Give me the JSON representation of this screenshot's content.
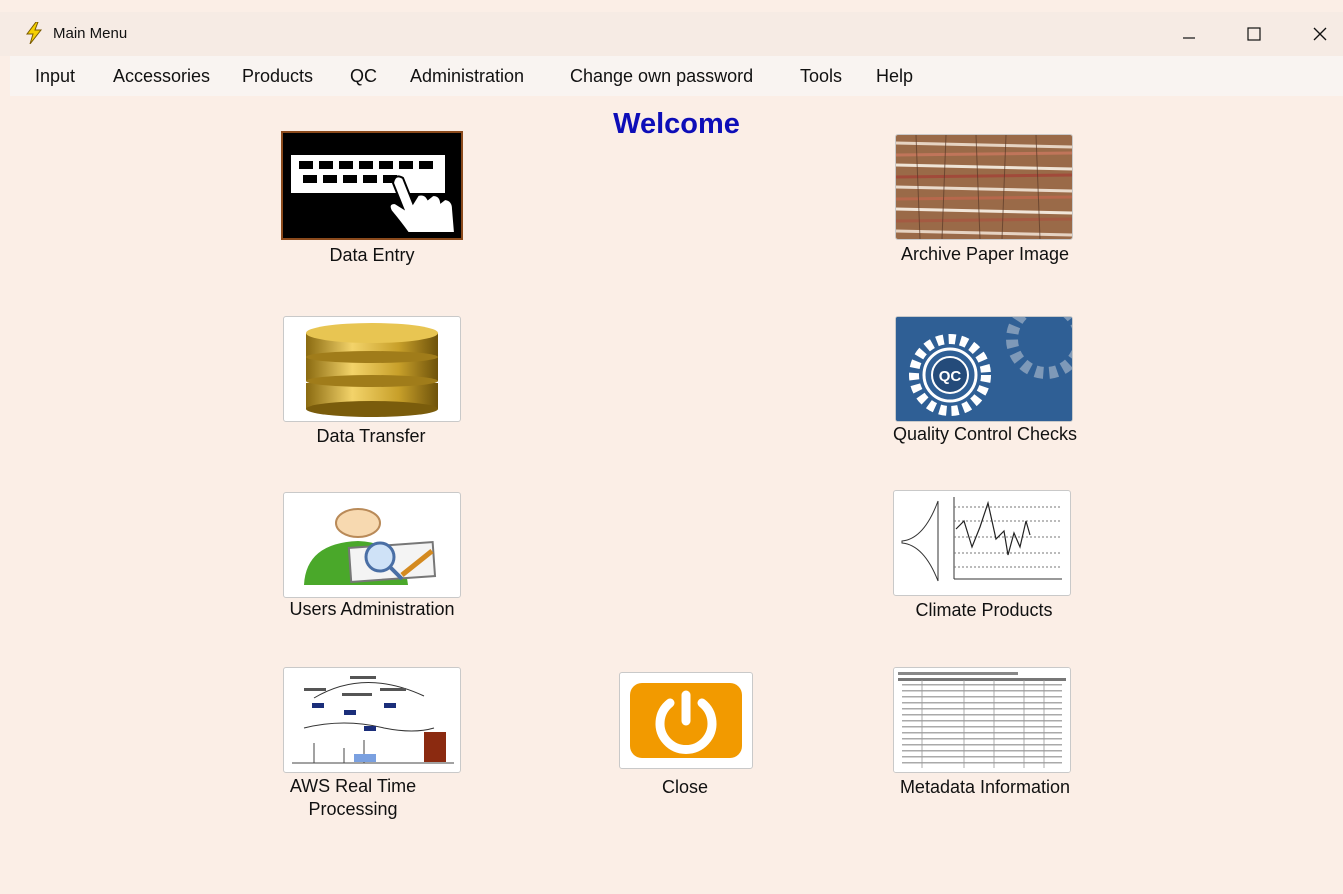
{
  "window": {
    "title": "Main Menu",
    "app_icon": "lightning-bolt-icon"
  },
  "title_buttons": {
    "minimize": "minimize-icon",
    "maximize": "maximize-icon",
    "close": "close-icon"
  },
  "menu": [
    "Input",
    "Accessories",
    "Products",
    "QC",
    "Administration",
    "Change own password",
    "Tools",
    "Help"
  ],
  "main": {
    "welcome": "Welcome",
    "tiles": {
      "data_entry": "Data Entry",
      "data_transfer": "Data Transfer",
      "users_admin": "Users Administration",
      "aws": "AWS Real Time Processing",
      "close": "Close",
      "archive": "Archive Paper Image",
      "qc": "Quality Control Checks",
      "qc_badge": "QC",
      "climate": "Climate Products",
      "metadata": "Metadata Information"
    }
  },
  "colors": {
    "background": "#fbeee6",
    "welcome": "#0d0db8",
    "close_orange": "#f29a00",
    "qc_blue": "#2f5f95"
  }
}
